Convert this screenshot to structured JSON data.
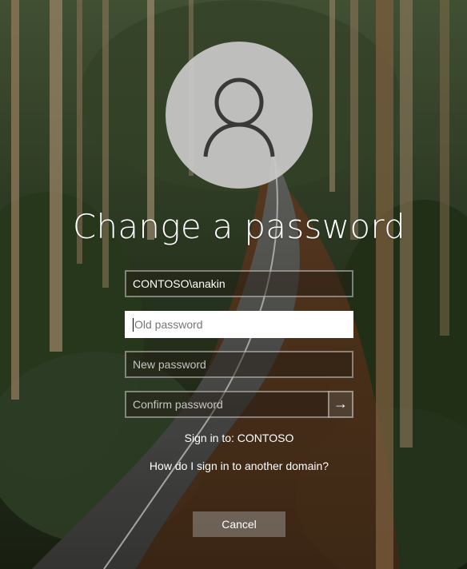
{
  "avatar": {
    "icon": "user-icon"
  },
  "title": "Change a password",
  "fields": {
    "username": {
      "value": "CONTOSO\\anakin"
    },
    "old_password": {
      "placeholder": "Old password"
    },
    "new_password": {
      "placeholder": "New password"
    },
    "confirm_password": {
      "placeholder": "Confirm password"
    }
  },
  "submit": {
    "icon": "arrow-right-icon",
    "glyph": "→"
  },
  "sign_in_to": "Sign in to: CONTOSO",
  "other_domain_link": "How do I sign in to another domain?",
  "cancel_label": "Cancel",
  "colors": {
    "text": "#ffffff",
    "avatar_bg": "#c9c9c9",
    "avatar_glyph": "#3a3a3a",
    "active_field_bg": "#ffffff"
  }
}
